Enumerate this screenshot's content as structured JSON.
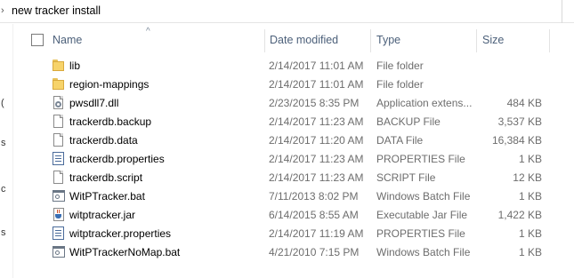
{
  "address": {
    "path": "new tracker install",
    "chevron": "›"
  },
  "left_pane_glyphs": [
    "(",
    "s",
    "c",
    "s"
  ],
  "columns": {
    "name": "Name",
    "date": "Date modified",
    "type": "Type",
    "size": "Size",
    "sort_indicator": "^"
  },
  "files": [
    {
      "name": "lib",
      "date": "2/14/2017 11:01 AM",
      "type": "File folder",
      "size": "",
      "icon": "folder-icon"
    },
    {
      "name": "region-mappings",
      "date": "2/14/2017 11:01 AM",
      "type": "File folder",
      "size": "",
      "icon": "folder-icon"
    },
    {
      "name": "pwsdll7.dll",
      "date": "2/23/2015 8:35 PM",
      "type": "Application extens...",
      "size": "484 KB",
      "icon": "dll-icon"
    },
    {
      "name": "trackerdb.backup",
      "date": "2/14/2017 11:23 AM",
      "type": "BACKUP File",
      "size": "3,537 KB",
      "icon": "document-icon"
    },
    {
      "name": "trackerdb.data",
      "date": "2/14/2017 11:20 AM",
      "type": "DATA File",
      "size": "16,384 KB",
      "icon": "document-icon"
    },
    {
      "name": "trackerdb.properties",
      "date": "2/14/2017 11:23 AM",
      "type": "PROPERTIES File",
      "size": "1 KB",
      "icon": "properties-icon"
    },
    {
      "name": "trackerdb.script",
      "date": "2/14/2017 11:23 AM",
      "type": "SCRIPT File",
      "size": "12 KB",
      "icon": "document-icon"
    },
    {
      "name": "WitPTracker.bat",
      "date": "7/11/2013 8:02 PM",
      "type": "Windows Batch File",
      "size": "1 KB",
      "icon": "batch-file-icon"
    },
    {
      "name": "witptracker.jar",
      "date": "6/14/2015 8:55 AM",
      "type": "Executable Jar File",
      "size": "1,422 KB",
      "icon": "java-jar-icon"
    },
    {
      "name": "witptracker.properties",
      "date": "2/14/2017 11:19 AM",
      "type": "PROPERTIES File",
      "size": "1 KB",
      "icon": "properties-icon"
    },
    {
      "name": "WitPTrackerNoMap.bat",
      "date": "4/21/2010 7:15 PM",
      "type": "Windows Batch File",
      "size": "1 KB",
      "icon": "batch-file-icon"
    }
  ]
}
